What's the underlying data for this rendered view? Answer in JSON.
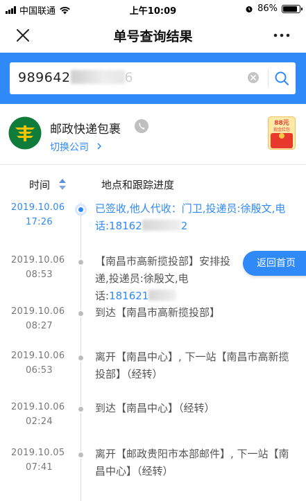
{
  "status_bar": {
    "carrier": "中国联通",
    "time": "上午10:09",
    "battery": "86%",
    "battery_level": 0.86
  },
  "nav": {
    "title": "单号查询结果"
  },
  "search": {
    "value": "989642",
    "value_tail": "6"
  },
  "company": {
    "name": "邮政快递包裹",
    "switch_label": "切换公司",
    "redpacket_amount": "88元",
    "redpacket_label": "现金红包"
  },
  "table_header": {
    "time": "时间",
    "progress": "地点和跟踪进度"
  },
  "floating_button": "返回首页",
  "timeline": [
    {
      "date": "2019.10.06",
      "clock": "17:26",
      "text_a": "已签收,他人代收：门卫,投递员:徐殷文,电话:18162",
      "text_b": "2",
      "active": true
    },
    {
      "date": "2019.10.06",
      "clock": "08:53",
      "text_a": "【南昌市高新揽投部】安排投递,投递员:徐殷文,电话:",
      "phone": "181621",
      "active": false
    },
    {
      "date": "2019.10.06",
      "clock": "08:27",
      "text_a": "到达【南昌市高新揽投部】",
      "active": false
    },
    {
      "date": "2019.10.06",
      "clock": "06:53",
      "text_a": "离开【南昌中心】, 下一站【南昌市高新揽投部】（经转）",
      "active": false
    },
    {
      "date": "2019.10.06",
      "clock": "02:24",
      "text_a": "到达【南昌中心】（经转）",
      "active": false
    },
    {
      "date": "2019.10.05",
      "clock": "07:41",
      "text_a": "离开【邮政贵阳市本部邮件】, 下一站【南昌中心】（经转）",
      "active": false
    }
  ]
}
